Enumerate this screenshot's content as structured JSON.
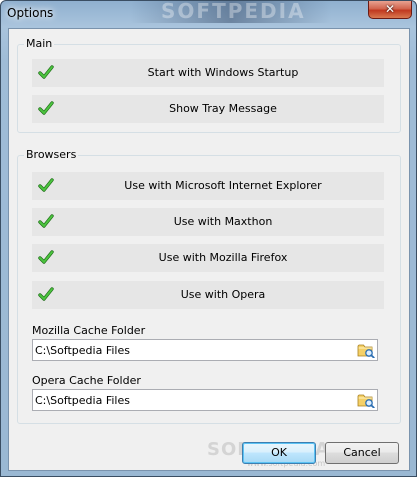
{
  "window": {
    "title": "Options",
    "close_glyph": "✕",
    "watermark": "SOFTPEDIA"
  },
  "main_group": {
    "label": "Main",
    "options": [
      {
        "label": "Start with Windows Startup",
        "checked": true
      },
      {
        "label": "Show Tray Message",
        "checked": true
      }
    ]
  },
  "browsers_group": {
    "label": "Browsers",
    "options": [
      {
        "label": "Use with Microsoft Internet Explorer",
        "checked": true
      },
      {
        "label": "Use with Maxthon",
        "checked": true
      },
      {
        "label": "Use with Mozilla Firefox",
        "checked": true
      },
      {
        "label": "Use with Opera",
        "checked": true
      }
    ],
    "mozilla_cache": {
      "label": "Mozilla Cache Folder",
      "value": "C:\\Softpedia Files"
    },
    "opera_cache": {
      "label": "Opera Cache Folder",
      "value": "C:\\Softpedia Files"
    }
  },
  "footer": {
    "ok_label": "OK",
    "cancel_label": "Cancel",
    "watermark": "SOFTPEDIA",
    "watermark_url": "www.softpedia.com"
  },
  "colors": {
    "check_green": "#3aa832",
    "title_glass": "#a9c4dd",
    "close_red": "#c0381f"
  },
  "icons": {
    "check": "check-icon",
    "folder": "browse-folder-icon",
    "close": "close-icon"
  }
}
